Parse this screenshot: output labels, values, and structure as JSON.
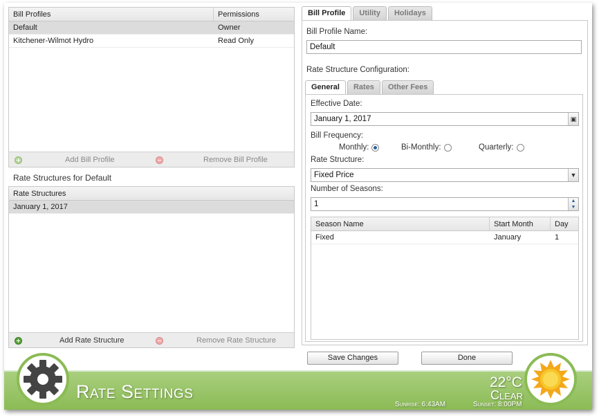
{
  "bill_profiles": {
    "columns": [
      "Bill Profiles",
      "Permissions"
    ],
    "rows": [
      {
        "name": "Default",
        "permission": "Owner"
      },
      {
        "name": "Kitchener-Wilmot Hydro",
        "permission": "Read Only"
      }
    ],
    "add_label": "Add Bill Profile",
    "remove_label": "Remove Bill Profile"
  },
  "rate_structures": {
    "section_title": "Rate Structures for Default",
    "columns": [
      "Rate Structures"
    ],
    "rows": [
      {
        "name": "January 1, 2017"
      }
    ],
    "add_label": "Add Rate Structure",
    "remove_label": "Remove Rate Structure"
  },
  "main_tabs": [
    {
      "label": "Bill Profile"
    },
    {
      "label": "Utility"
    },
    {
      "label": "Holidays"
    }
  ],
  "bill_profile_name": {
    "label": "Bill Profile Name:",
    "value": "Default"
  },
  "rate_config": {
    "label": "Rate Structure Configuration:",
    "tabs": [
      {
        "label": "General"
      },
      {
        "label": "Rates"
      },
      {
        "label": "Other Fees"
      }
    ],
    "effective_date": {
      "label": "Effective Date:",
      "value": "January 1, 2017"
    },
    "bill_frequency": {
      "label": "Bill Frequency:",
      "options": [
        {
          "label": "Monthly:",
          "checked": true
        },
        {
          "label": "Bi-Monthly:",
          "checked": false
        },
        {
          "label": "Quarterly:",
          "checked": false
        }
      ]
    },
    "rate_structure": {
      "label": "Rate Structure:",
      "value": "Fixed Price"
    },
    "seasons": {
      "label": "Number of Seasons:",
      "value": "1"
    },
    "season_table": {
      "columns": [
        "Season Name",
        "Start Month",
        "Day"
      ],
      "rows": [
        {
          "name": "Fixed",
          "month": "January",
          "day": "1"
        }
      ]
    }
  },
  "actions": {
    "save": "Save Changes",
    "done": "Done"
  },
  "footer": {
    "title": "Rate Settings",
    "temperature": "22°C",
    "condition": "Clear",
    "sunrise": "Sunrise: 6:43AM",
    "sunset": "Sunset: 8:00PM"
  }
}
